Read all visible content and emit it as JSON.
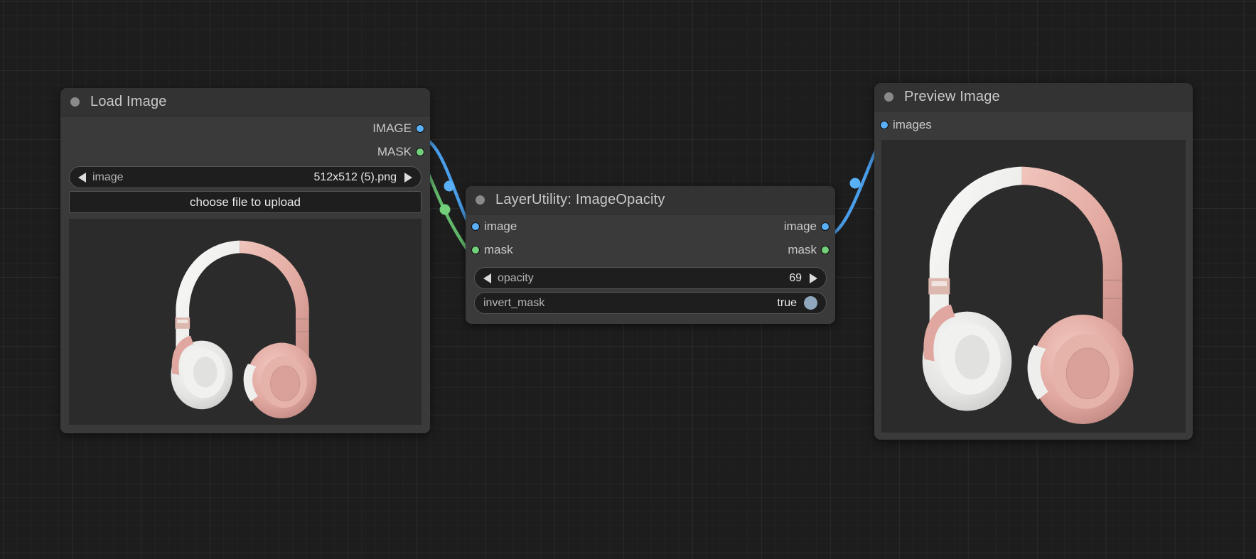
{
  "app": {
    "canvas_background": "#1d1d1d",
    "grid_color": "#2a2a2a"
  },
  "colors": {
    "image_port": "#5ab0f5",
    "mask_port": "#73d07a",
    "node_body": "#3a3a3a",
    "node_title": "#333333",
    "widget_bg": "#1e1e1e",
    "toggle_knob": "#8fa8bd"
  },
  "nodes": [
    {
      "id": "load-image",
      "title": "Load Image",
      "outputs": [
        {
          "label": "IMAGE",
          "color": "#5ab0f5"
        },
        {
          "label": "MASK",
          "color": "#73d07a"
        }
      ],
      "widgets": [
        {
          "type": "combo",
          "name": "image",
          "value": "512x512 (5).png"
        },
        {
          "type": "button",
          "label": "choose file to upload"
        }
      ],
      "preview": "rose-gold-headphones"
    },
    {
      "id": "layerutility-imageopacity",
      "title": "LayerUtility: ImageOpacity",
      "inputs": [
        {
          "label": "image",
          "color": "#5ab0f5"
        },
        {
          "label": "mask",
          "color": "#73d07a"
        }
      ],
      "outputs": [
        {
          "label": "image",
          "color": "#5ab0f5"
        },
        {
          "label": "mask",
          "color": "#73d07a"
        }
      ],
      "widgets": [
        {
          "type": "number",
          "name": "opacity",
          "value": "69"
        },
        {
          "type": "toggle",
          "name": "invert_mask",
          "value": "true"
        }
      ]
    },
    {
      "id": "preview-image",
      "title": "Preview Image",
      "inputs": [
        {
          "label": "images",
          "color": "#5ab0f5"
        }
      ],
      "preview": "rose-gold-headphones"
    }
  ],
  "links": [
    {
      "from": "load-image.IMAGE",
      "to": "layerutility-imageopacity.image",
      "color": "#4a9eea"
    },
    {
      "from": "load-image.MASK",
      "to": "layerutility-imageopacity.mask",
      "color": "#63b86c"
    },
    {
      "from": "layerutility-imageopacity.image",
      "to": "preview-image.images",
      "color": "#4a9eea"
    }
  ]
}
